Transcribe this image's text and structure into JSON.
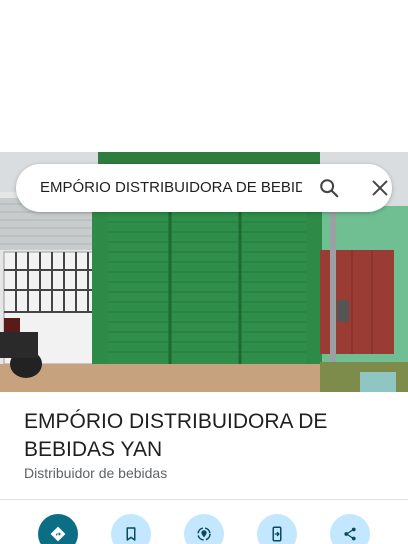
{
  "search": {
    "query": "EMPÓRIO DISTRIBUIDORA DE BEBIDAS YAN"
  },
  "place": {
    "name": "EMPÓRIO DISTRIBUIDORA DE BEBIDAS YAN",
    "category": "Distribuidor de bebidas"
  },
  "actions": [
    {
      "icon": "directions-icon"
    },
    {
      "icon": "bookmark-icon"
    },
    {
      "icon": "nearby-icon"
    },
    {
      "icon": "send-to-phone-icon"
    },
    {
      "icon": "share-icon"
    }
  ],
  "colors": {
    "primary_action": "#0b6e85",
    "secondary_action": "#c2e7ff",
    "storefront_green": "#2e8b47"
  }
}
